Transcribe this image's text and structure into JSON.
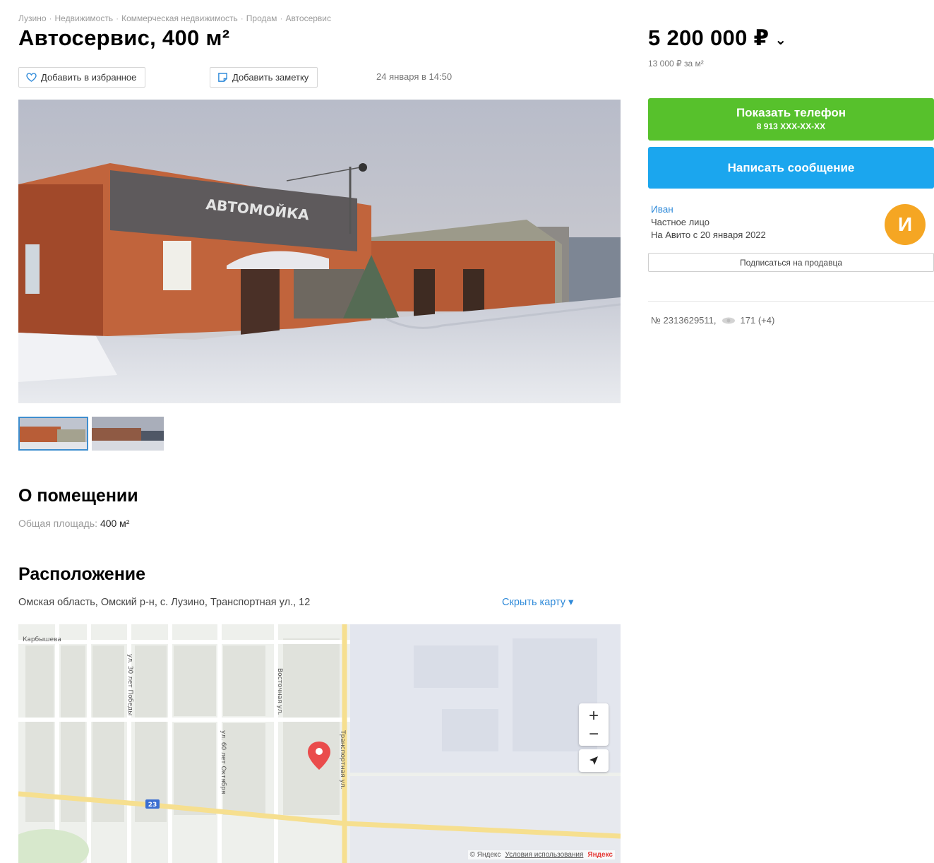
{
  "breadcrumb": [
    "Лузино",
    "Недвижимость",
    "Коммерческая недвижимость",
    "Продам",
    "Автосервис"
  ],
  "title": "Автосервис, 400 м²",
  "actions": {
    "favorite_label": "Добавить в избранное",
    "note_label": "Добавить заметку",
    "date": "24 января в 14:50"
  },
  "photo": {
    "sign_text": "АВТОМОЙКА"
  },
  "sections": {
    "about_title": "О помещении",
    "area_label": "Общая площадь:",
    "area_value": "400 м²",
    "location_title": "Расположение",
    "address": "Омская область, Омский р-н, с. Лузино, Транспортная ул., 12",
    "hide_map": "Скрыть карту ▾"
  },
  "map": {
    "streets": [
      "Карбышева",
      "ул. 30 лет Победы",
      "Восточная ул.",
      "Транспортная ул.",
      "ул. 60 лет Октября"
    ],
    "route_badge": "23",
    "zoom_in": "+",
    "zoom_out": "−",
    "footer_copy": "© Яндекс",
    "footer_terms": "Условия использования",
    "footer_logo": "Яндекс"
  },
  "price": {
    "value": "5 200 000 ₽",
    "chevron": "⌄",
    "per_sqm": "13 000 ₽ за м²"
  },
  "contact": {
    "phone_label": "Показать телефон",
    "phone_masked": "8 913 XXX-XX-XX",
    "message_label": "Написать сообщение"
  },
  "seller": {
    "name": "Иван",
    "type": "Частное лицо",
    "since": "На Авито с 20 января 2022",
    "avatar_letter": "И",
    "subscribe_label": "Подписаться на продавца"
  },
  "ad": {
    "number": "№ 2313629511,",
    "views": "171 (+4)"
  },
  "colors": {
    "phone_button": "#57c12c",
    "message_button": "#1ba6ee",
    "link": "#2f8ad9",
    "avatar": "#f5a623"
  }
}
